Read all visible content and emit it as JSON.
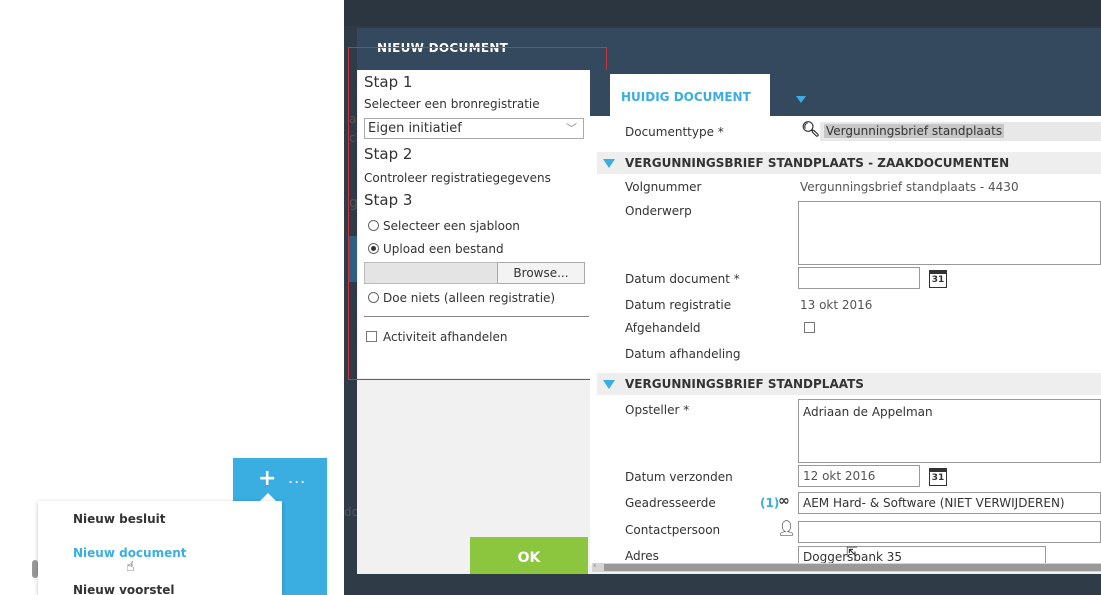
{
  "widget": {
    "plus": "+",
    "dots": "...",
    "menu_items": [
      "Nieuw besluit",
      "Nieuw document",
      "Nieuw voorstel"
    ]
  },
  "dialog": {
    "title": "NIEUW DOCUMENT",
    "ok_label": "OK"
  },
  "background_texts": [
    "ak",
    "cla",
    "ge",
    "do"
  ],
  "steps": {
    "step1_title": "Stap 1",
    "step1_sub": "Selecteer een bronregistratie",
    "bron_value": "Eigen initiatief",
    "step2_title": "Stap 2",
    "step2_sub": "Controleer registratiegegevens",
    "step3_title": "Stap 3",
    "option_template": "Selecteer een sjabloon",
    "option_upload": "Upload een bestand",
    "browse_label": "Browse...",
    "option_nothing": "Doe niets (alleen registratie)",
    "activity_label": "Activiteit afhandelen"
  },
  "tab": {
    "label": "HUIDIG DOCUMENT"
  },
  "form": {
    "doctype_label": "Documenttype *",
    "doctype_value": "Vergunningsbrief standplaats",
    "section1": "VERGUNNINGSBRIEF STANDPLAATS - ZAAKDOCUMENTEN",
    "volg_label": "Volgnummer",
    "volg_value": "Vergunningsbrief standplaats - 4430",
    "onderwerp_label": "Onderwerp",
    "datdoc_label": "Datum document *",
    "cal_day": "31",
    "datreg_label": "Datum registratie",
    "datreg_value": "13 okt 2016",
    "afgeh_label": "Afgehandeld",
    "datafh_label": "Datum afhandeling",
    "section2": "VERGUNNINGSBRIEF STANDPLAATS",
    "opsteller_label": "Opsteller *",
    "opsteller_value": "Adriaan de Appelman",
    "datverz_label": "Datum verzonden",
    "datverz_value": "12 okt 2016",
    "geadr_label": "Geadresseerde",
    "geadr_count": "(1)",
    "geadr_value": "AEM Hard- & Software (NIET VERWIJDEREN)",
    "contact_label": "Contactpersoon",
    "adres_label": "Adres",
    "adres_value": "Doggersbank 35"
  },
  "colors": {
    "accent": "#3aaee0",
    "ok_green": "#8cc63f",
    "titlebar": "#34495e",
    "highlight_outline": "#c8323c"
  }
}
